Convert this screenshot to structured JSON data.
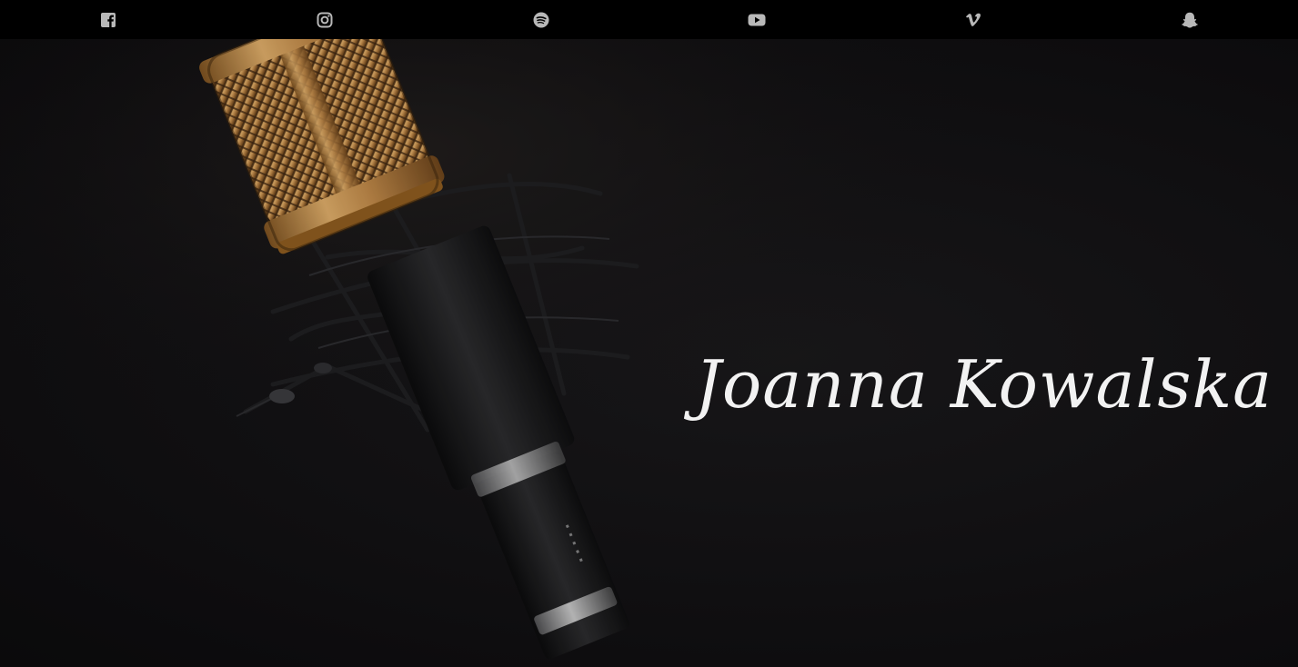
{
  "nav": {
    "social_links": [
      {
        "network": "facebook",
        "icon": "facebook-icon"
      },
      {
        "network": "instagram",
        "icon": "instagram-icon"
      },
      {
        "network": "spotify",
        "icon": "spotify-icon"
      },
      {
        "network": "youtube",
        "icon": "youtube-icon"
      },
      {
        "network": "vimeo",
        "icon": "vimeo-icon"
      },
      {
        "network": "snapchat",
        "icon": "snapchat-icon"
      }
    ],
    "icon_color": "#b8b8b8",
    "background": "#000000"
  },
  "hero": {
    "artist_name": "Joanna Kowalska",
    "name_color": "#f2f2f2",
    "background_color": "#121113",
    "accent_gold": "#c9944f"
  }
}
